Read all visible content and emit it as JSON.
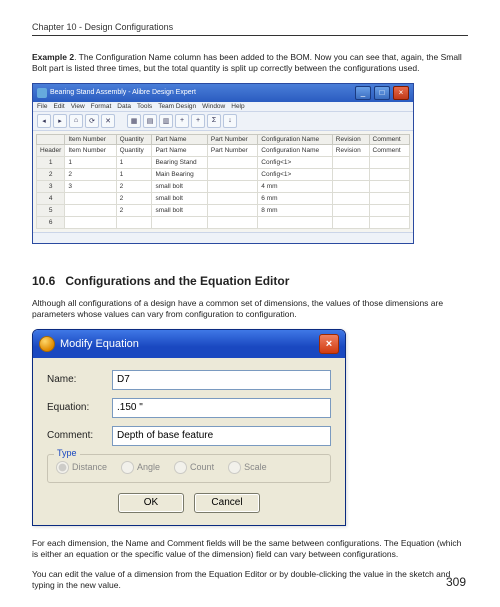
{
  "chapter_header": "Chapter 10 - Design Configurations",
  "example_label": "Example 2",
  "example_text": ". The Configuration Name column has been added to the BOM. Now you can see that, again, the Small Bolt part is listed three times, but the total quantity is split up correctly between the configurations used.",
  "bom_window": {
    "title": "Bearing Stand Assembly - Alibre Design Expert",
    "menu": [
      "File",
      "Edit",
      "View",
      "Format",
      "Data",
      "Tools",
      "Team Design",
      "Window",
      "Help"
    ],
    "columns": [
      "",
      "Item Number",
      "Quantity",
      "Part Name",
      "Part Number",
      "Configuration Name",
      "Revision",
      "Comment"
    ],
    "header_row_label": "Header",
    "rows": [
      {
        "n": "1",
        "item": "1",
        "qty": "1",
        "part": "Bearing Stand",
        "pn": "",
        "cfg": "Config<1>",
        "rev": "",
        "cmt": ""
      },
      {
        "n": "2",
        "item": "2",
        "qty": "1",
        "part": "Main Bearing",
        "pn": "",
        "cfg": "Config<1>",
        "rev": "",
        "cmt": ""
      },
      {
        "n": "3",
        "item": "3",
        "qty": "2",
        "part": "small bolt",
        "pn": "",
        "cfg": "4 mm",
        "rev": "",
        "cmt": ""
      },
      {
        "n": "4",
        "item": "",
        "qty": "2",
        "part": "small bolt",
        "pn": "",
        "cfg": "6 mm",
        "rev": "",
        "cmt": ""
      },
      {
        "n": "5",
        "item": "",
        "qty": "2",
        "part": "small bolt",
        "pn": "",
        "cfg": "8 mm",
        "rev": "",
        "cmt": ""
      },
      {
        "n": "6",
        "item": "",
        "qty": "",
        "part": "",
        "pn": "",
        "cfg": "",
        "rev": "",
        "cmt": ""
      }
    ]
  },
  "section_number": "10.6",
  "section_title": "Configurations and the Equation Editor",
  "intro_text": "Although all configurations of a design have a common set of dimensions, the values of those dimensions are parameters whose values can vary from configuration to configuration.",
  "dialog": {
    "title": "Modify Equation",
    "name_label": "Name:",
    "name_value": "D7",
    "equation_label": "Equation:",
    "equation_value": ".150 \"",
    "comment_label": "Comment:",
    "comment_value": "Depth of base feature",
    "type_legend": "Type",
    "options": {
      "distance": "Distance",
      "angle": "Angle",
      "count": "Count",
      "scale": "Scale"
    },
    "selected_option": "distance",
    "ok": "OK",
    "cancel": "Cancel"
  },
  "para2": "For each dimension, the Name and Comment fields will be the same between configurations. The Equation (which is either an equation or the specific value of the dimension) field can vary between configurations.",
  "para3": "You can edit the value of a dimension from the Equation Editor or by double-clicking the value in the sketch and typing in the new value.",
  "page_number": "309"
}
